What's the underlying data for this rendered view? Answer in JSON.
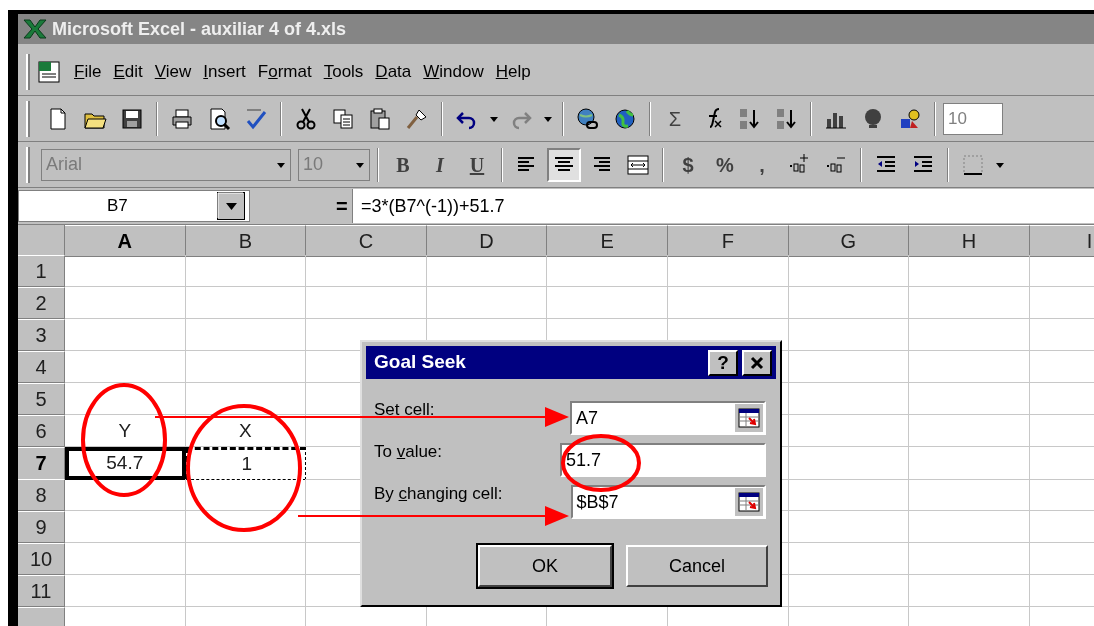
{
  "window": {
    "title": "Microsoft Excel - auxiliar 4 of 4.xls"
  },
  "menu": [
    {
      "label": {
        "key": "F",
        "after": "ile"
      }
    },
    {
      "label": {
        "key": "E",
        "after": "dit"
      }
    },
    {
      "label": {
        "key": "V",
        "after": "iew"
      }
    },
    {
      "label": {
        "key": "I",
        "after": "nsert"
      }
    },
    {
      "label": {
        "before": "F",
        "key": "o",
        "after": "rmat"
      }
    },
    {
      "label": {
        "key": "T",
        "after": "ools"
      }
    },
    {
      "label": {
        "key": "D",
        "after": "ata"
      }
    },
    {
      "label": {
        "key": "W",
        "after": "indow"
      }
    },
    {
      "label": {
        "key": "H",
        "after": "elp"
      }
    }
  ],
  "standard_toolbar": [
    {
      "kind": "icon"
    },
    {
      "kind": "icon"
    },
    {
      "kind": "icon"
    },
    {
      "kind": "sep"
    },
    {
      "kind": "icon"
    },
    {
      "kind": "icon"
    },
    {
      "kind": "icon"
    },
    {
      "kind": "sep"
    },
    {
      "kind": "icon"
    },
    {
      "kind": "icon"
    },
    {
      "kind": "icon"
    },
    {
      "kind": "icon"
    },
    {
      "kind": "sep"
    },
    {
      "kind": "icon"
    },
    {
      "kind": "icon"
    },
    {
      "kind": "icon"
    },
    {
      "kind": "icon"
    },
    {
      "kind": "sep"
    },
    {
      "kind": "icon"
    },
    {
      "kind": "icon"
    },
    {
      "kind": "sep"
    },
    {
      "kind": "text",
      "text": "Σ"
    },
    {
      "kind": "icon"
    },
    {
      "kind": "icon"
    },
    {
      "kind": "icon"
    },
    {
      "kind": "sep"
    },
    {
      "kind": "icon"
    },
    {
      "kind": "icon"
    },
    {
      "kind": "icon"
    },
    {
      "kind": "sep"
    },
    {
      "kind": "combo",
      "text": "10"
    }
  ],
  "format_toolbar": [
    {
      "kind": "fontbox",
      "text": "Arial"
    },
    {
      "kind": "sizebox",
      "text": "10"
    },
    {
      "kind": "sep"
    },
    {
      "kind": "text",
      "text": "B",
      "pressed": false
    },
    {
      "kind": "text",
      "text": "I",
      "pressed": false
    },
    {
      "kind": "text",
      "text": "U",
      "pressed": false
    },
    {
      "kind": "sep"
    },
    {
      "kind": "icon",
      "pressed": false
    },
    {
      "kind": "icon",
      "pressed": true
    },
    {
      "kind": "icon",
      "pressed": false
    },
    {
      "kind": "icon",
      "pressed": false
    },
    {
      "kind": "sep"
    },
    {
      "kind": "text",
      "text": "$",
      "pressed": false
    },
    {
      "kind": "text",
      "text": "%",
      "pressed": false
    },
    {
      "kind": "text",
      "text": ",",
      "pressed": false
    },
    {
      "kind": "icon",
      "pressed": false
    },
    {
      "kind": "icon",
      "pressed": false
    },
    {
      "kind": "sep"
    },
    {
      "kind": "icon",
      "pressed": false
    },
    {
      "kind": "icon",
      "pressed": false
    },
    {
      "kind": "sep"
    },
    {
      "kind": "icon",
      "pressed": false
    },
    {
      "kind": "icon"
    }
  ],
  "formula_bar": {
    "name_box": "B7",
    "equals": "=",
    "formula": "=3*(B7^(-1))+51.7"
  },
  "sheet": {
    "columns": [
      {
        "label": "A",
        "selected": true
      },
      {
        "label": "B",
        "selected": false
      },
      {
        "label": "C",
        "selected": false
      },
      {
        "label": "D",
        "selected": false
      },
      {
        "label": "E",
        "selected": false
      },
      {
        "label": "F",
        "selected": false
      },
      {
        "label": "G",
        "selected": false
      },
      {
        "label": "H",
        "selected": false
      },
      {
        "label": "I",
        "selected": false
      }
    ],
    "rows": [
      {
        "number": "1",
        "selected": false
      },
      {
        "number": "2",
        "selected": false
      },
      {
        "number": "3",
        "selected": false
      },
      {
        "number": "4",
        "selected": false
      },
      {
        "number": "5",
        "selected": false
      },
      {
        "number": "6",
        "selected": false,
        "cells": [
          {
            "value": "Y",
            "selected": false,
            "marquee": false
          },
          {
            "value": "X",
            "selected": false,
            "marquee": false
          }
        ]
      },
      {
        "number": "7",
        "selected": true,
        "cells": [
          {
            "value": "54.7",
            "selected": true,
            "marquee": false
          },
          {
            "value": "1",
            "selected": false,
            "marquee": true
          }
        ]
      },
      {
        "number": "8",
        "selected": false
      },
      {
        "number": "9",
        "selected": false
      },
      {
        "number": "10",
        "selected": false
      },
      {
        "number": "11",
        "selected": false
      }
    ]
  },
  "dialog": {
    "title": "Goal Seek",
    "help": "?",
    "fields": [
      {
        "label": {
          "key": "S",
          "after": "et cell:"
        },
        "value": "A7",
        "picker": true
      },
      {
        "label": {
          "before": "To ",
          "key": "v",
          "after": "alue:"
        },
        "value": "51.7",
        "picker": false
      },
      {
        "label": {
          "before": "By ",
          "key": "c",
          "after": "hanging cell:"
        },
        "value": "$B$7",
        "picker": true
      }
    ],
    "buttons": [
      {
        "label": "OK",
        "default": true
      },
      {
        "label": "Cancel",
        "default": false
      }
    ]
  }
}
